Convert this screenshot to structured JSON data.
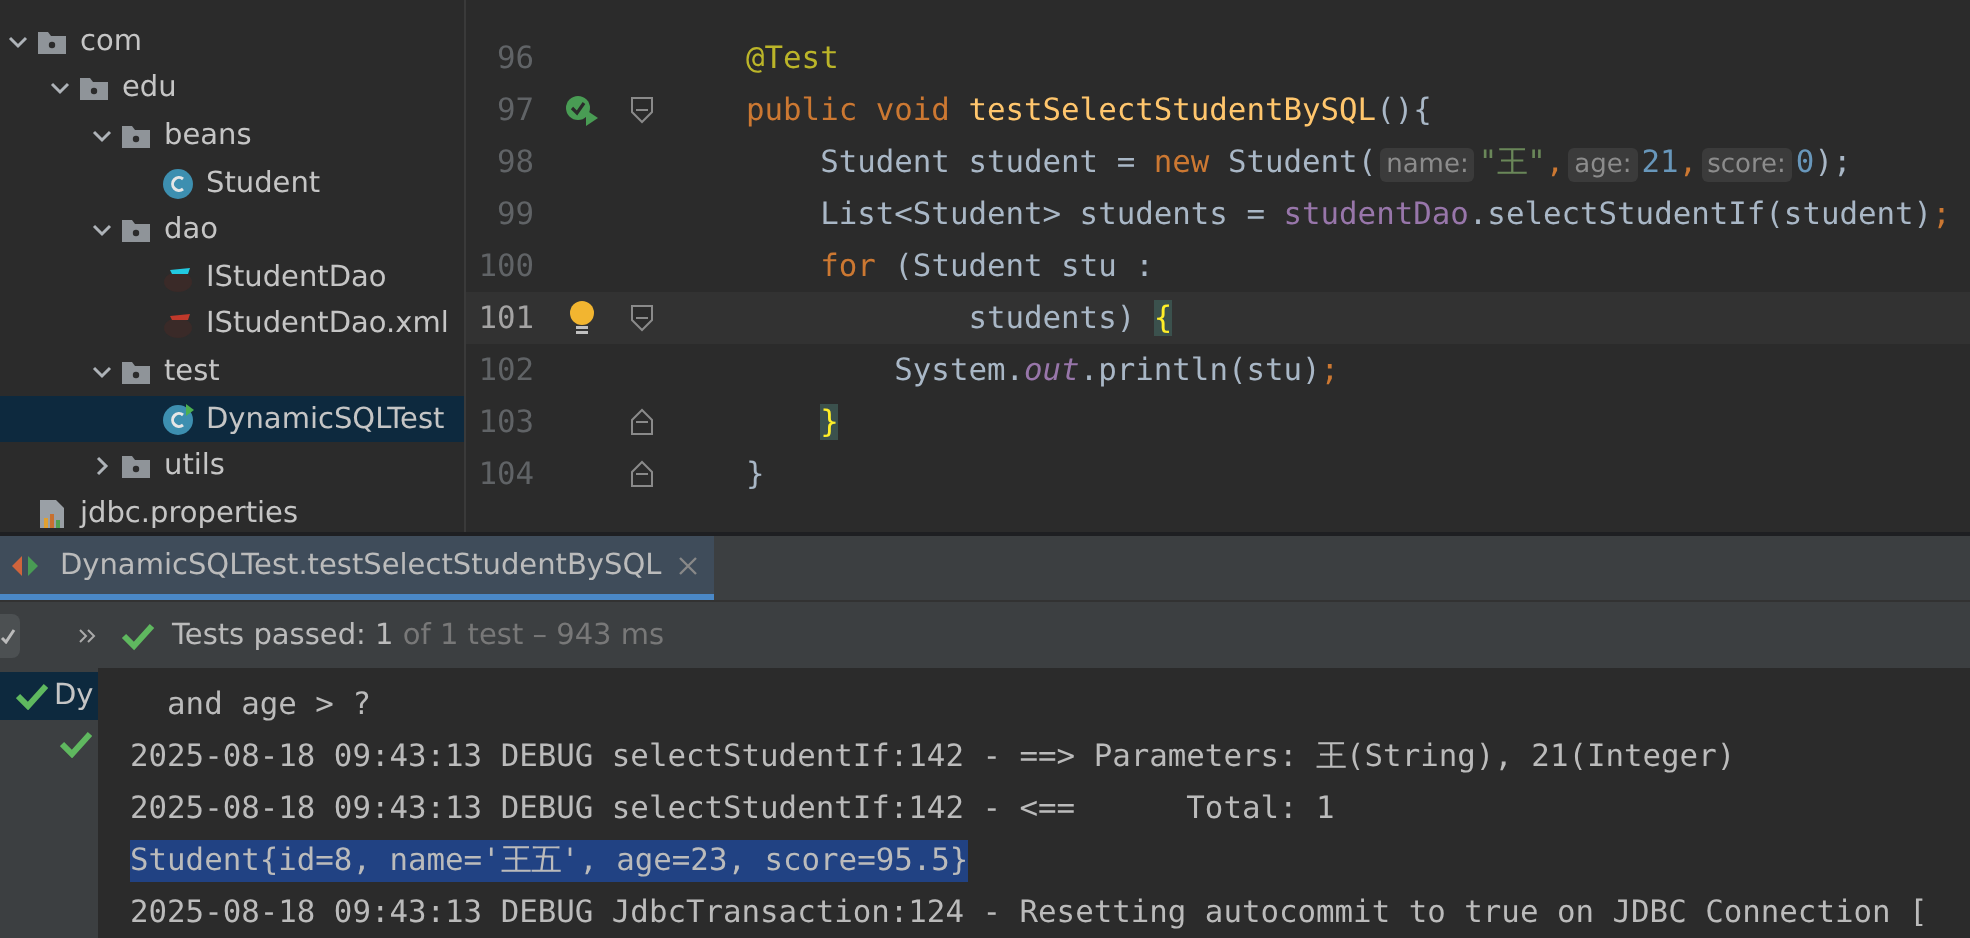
{
  "project_tree": [
    {
      "label": "com",
      "kind": "folder",
      "expanded": true,
      "selected": false,
      "children": [
        {
          "label": "edu",
          "kind": "folder",
          "expanded": true,
          "selected": false,
          "children": [
            {
              "label": "beans",
              "kind": "folder",
              "expanded": true,
              "selected": false,
              "children": [
                {
                  "label": "Student",
                  "kind": "class",
                  "selected": false
                }
              ]
            },
            {
              "label": "dao",
              "kind": "folder",
              "expanded": true,
              "selected": false,
              "children": [
                {
                  "label": "IStudentDao",
                  "kind": "mapper",
                  "selected": false
                },
                {
                  "label": "IStudentDao.xml",
                  "kind": "mapper-xml",
                  "selected": false
                }
              ]
            },
            {
              "label": "test",
              "kind": "folder",
              "expanded": true,
              "selected": false,
              "children": [
                {
                  "label": "DynamicSQLTest",
                  "kind": "test-class",
                  "selected": true
                }
              ]
            },
            {
              "label": "utils",
              "kind": "folder",
              "expanded": false,
              "selected": false
            }
          ]
        }
      ]
    },
    {
      "label": "jdbc.properties",
      "kind": "properties",
      "selected": false
    }
  ],
  "editor": {
    "lines": [
      {
        "number": "96",
        "current": false,
        "tokens": [
          {
            "text": "@Test",
            "kind": "annotation"
          }
        ]
      },
      {
        "number": "97",
        "current": false,
        "run_button": true,
        "fold_start": true,
        "tokens": [
          {
            "text": "public void ",
            "kind": "keyword"
          },
          {
            "text": "testSelectStudentBySQL",
            "kind": "method"
          },
          {
            "text": "(){",
            "kind": "plain"
          }
        ]
      },
      {
        "number": "98",
        "current": false,
        "tokens": [
          {
            "text": "    Student student = ",
            "kind": "plain"
          },
          {
            "text": "new ",
            "kind": "keyword"
          },
          {
            "text": "Student(",
            "kind": "plain"
          },
          {
            "text": "name:",
            "kind": "hint"
          },
          {
            "text": "\"王\"",
            "kind": "string"
          },
          {
            "text": ",",
            "kind": "keyword"
          },
          {
            "text": "age:",
            "kind": "hint"
          },
          {
            "text": "21",
            "kind": "number"
          },
          {
            "text": ",",
            "kind": "keyword"
          },
          {
            "text": "score:",
            "kind": "hint"
          },
          {
            "text": "0",
            "kind": "number"
          },
          {
            "text": ");",
            "kind": "plain"
          }
        ]
      },
      {
        "number": "99",
        "current": false,
        "tokens": [
          {
            "text": "    List<Student> students = ",
            "kind": "plain"
          },
          {
            "text": "studentDao",
            "kind": "field"
          },
          {
            "text": ".selectStudentIf(student)",
            "kind": "plain"
          },
          {
            "text": ";",
            "kind": "keyword"
          }
        ]
      },
      {
        "number": "100",
        "current": false,
        "tokens": [
          {
            "text": "    for ",
            "kind": "keyword"
          },
          {
            "text": "(Student stu :",
            "kind": "plain"
          }
        ]
      },
      {
        "number": "101",
        "current": true,
        "bulb": true,
        "fold_start": true,
        "tokens": [
          {
            "text": "            students) ",
            "kind": "plain"
          },
          {
            "text": "{",
            "kind": "brace"
          }
        ]
      },
      {
        "number": "102",
        "current": false,
        "tokens": [
          {
            "text": "        System.",
            "kind": "plain"
          },
          {
            "text": "out",
            "kind": "static"
          },
          {
            "text": ".println(stu)",
            "kind": "plain"
          },
          {
            "text": ";",
            "kind": "keyword"
          }
        ]
      },
      {
        "number": "103",
        "current": false,
        "fold_end": true,
        "tokens": [
          {
            "text": "    }",
            "kind": "brace"
          }
        ]
      },
      {
        "number": "104",
        "current": false,
        "fold_end": true,
        "tokens": [
          {
            "text": "}",
            "kind": "plain"
          }
        ]
      }
    ]
  },
  "run_panel": {
    "tab": {
      "title": "DynamicSQLTest.testSelectStudentBySQL",
      "selected": true
    },
    "status": {
      "title": "Tests passed:",
      "count": "1",
      "detail": "of 1 test – 943 ms"
    },
    "test_tree": [
      {
        "label": "Dy",
        "passed": true,
        "selected": true
      },
      {
        "passed": true,
        "selected": false
      }
    ],
    "console": [
      {
        "text": "  and age > ?",
        "selected": false
      },
      {
        "text": "2025-08-18 09:43:13 DEBUG selectStudentIf:142 - ==> Parameters: 王(String), 21(Integer)",
        "selected": false
      },
      {
        "text": "2025-08-18 09:43:13 DEBUG selectStudentIf:142 - <==      Total: 1",
        "selected": false
      },
      {
        "text": "Student{id=8, name='王五', age=23, score=95.5}",
        "selected": true
      },
      {
        "text": "2025-08-18 09:43:13 DEBUG JdbcTransaction:124 - Resetting autocommit to true on JDBC Connection [",
        "selected": false
      }
    ]
  }
}
